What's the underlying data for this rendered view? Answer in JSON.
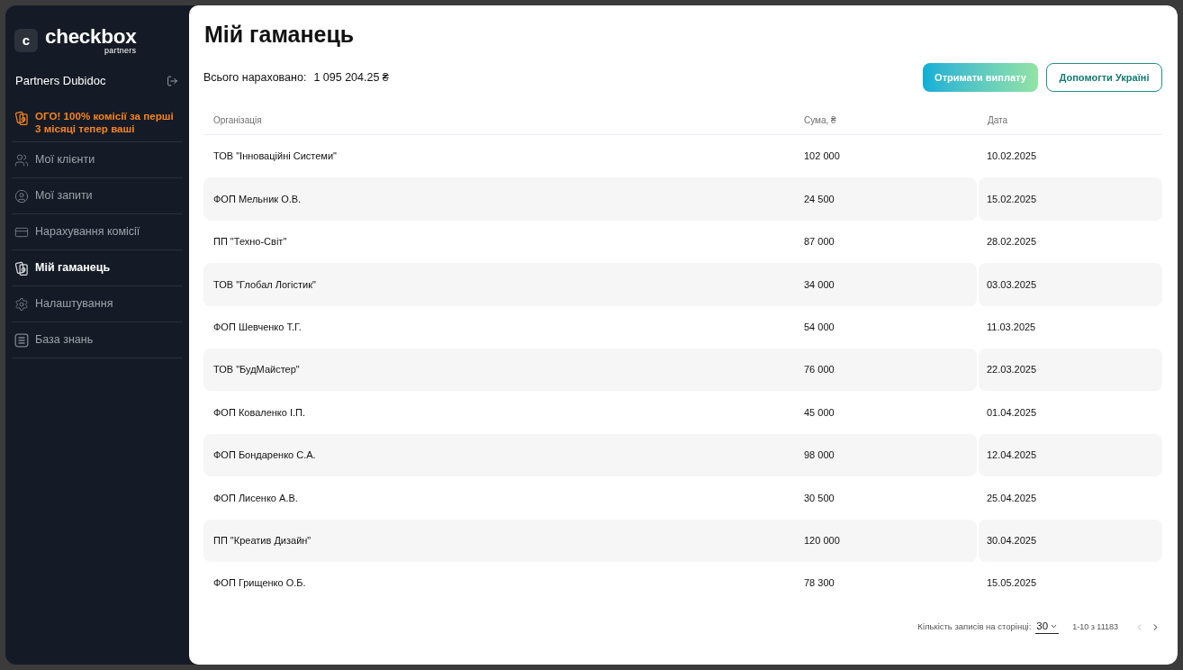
{
  "sidebar": {
    "logo": {
      "mark": "c",
      "name": "checkbox",
      "subtitle": "partners"
    },
    "account": {
      "name": "Partners Dubidoc"
    },
    "promo": {
      "text": "ОГО! 100% комісії за перші 3 місяці тепер ваші"
    },
    "items": [
      {
        "label": "Мої клієнти",
        "selected": false
      },
      {
        "label": "Мої запити",
        "selected": false
      },
      {
        "label": "Нарахування комісії",
        "selected": false
      },
      {
        "label": "Мій гаманець",
        "selected": true
      },
      {
        "label": "Налаштування",
        "selected": false
      },
      {
        "label": "База знань",
        "selected": false
      }
    ]
  },
  "main": {
    "title": "Мій гаманець",
    "total": {
      "label": "Всього нараховано:",
      "value": "1 095 204.25 ₴"
    },
    "buttons": [
      {
        "label": "Отримати виплату",
        "kind": "primary"
      },
      {
        "label": "Допомогти Україні",
        "kind": "outline"
      }
    ],
    "table": {
      "columns": [
        "Організація",
        "Сума, ₴",
        "Дата"
      ],
      "rows": [
        [
          "ТОВ \"Інноваційні Системи\"",
          "102 000",
          "10.02.2025"
        ],
        [
          "ФОП Мельник О.В.",
          "24 500",
          "15.02.2025"
        ],
        [
          "ПП \"Техно-Світ\"",
          "87 000",
          "28.02.2025"
        ],
        [
          "ТОВ \"Глобал Логістик\"",
          "34 000",
          "03.03.2025"
        ],
        [
          "ФОП Шевченко Т.Г.",
          "54 000",
          "11.03.2025"
        ],
        [
          "ТОВ \"БудМайстер\"",
          "76 000",
          "22.03.2025"
        ],
        [
          "ФОП Коваленко І.П.",
          "45 000",
          "01.04.2025"
        ],
        [
          "ФОП Бондаренко С.А.",
          "98 000",
          "12.04.2025"
        ],
        [
          "ФОП Лисенко А.В.",
          "30 500",
          "25.04.2025"
        ],
        [
          "ПП \"Креатив Дизайн\"",
          "120 000",
          "30.04.2025"
        ],
        [
          "ФОП Грищенко О.Б.",
          "78 300",
          "15.05.2025"
        ]
      ]
    },
    "pagination": {
      "label": "Кількість записів на сторінці:",
      "page_size": "30",
      "range": "1-10 з 11183",
      "prev": {
        "disabled": true
      },
      "next": {
        "disabled": false
      }
    }
  }
}
